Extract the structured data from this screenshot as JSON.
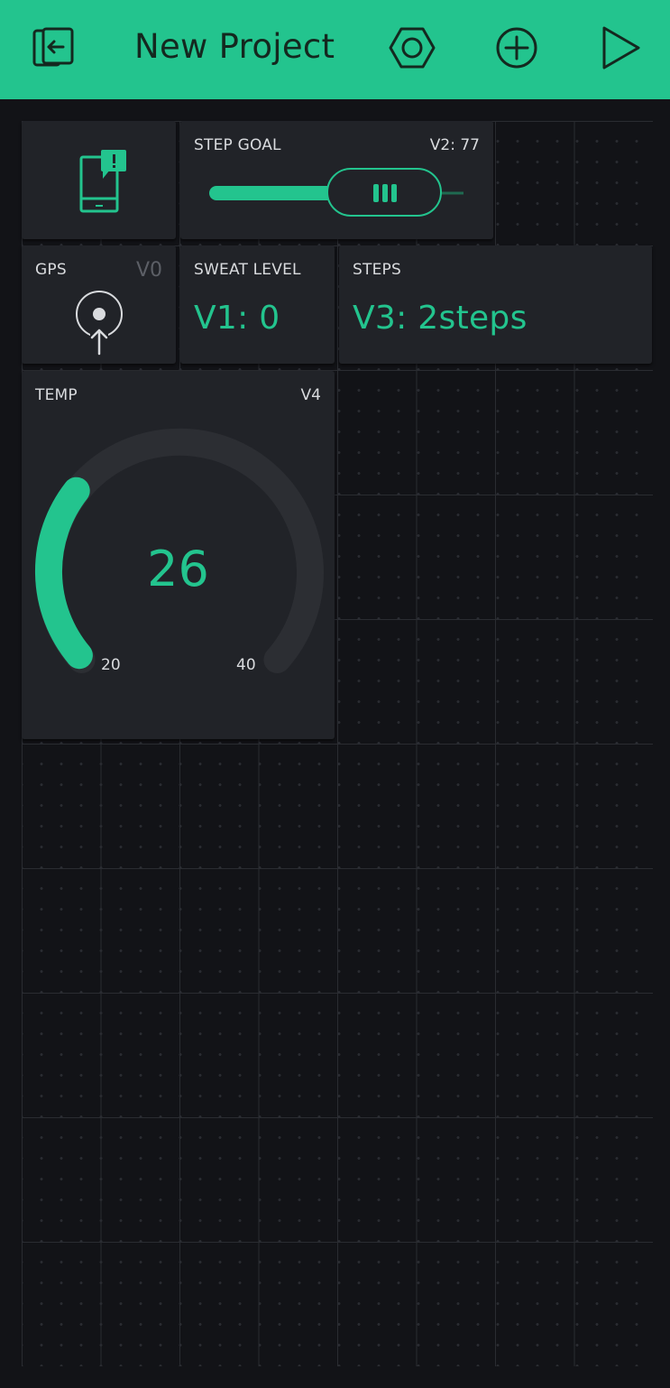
{
  "header": {
    "title": "New Project",
    "background": "#23c48e",
    "icons": [
      "exit-app-icon",
      "settings-hexagon-icon",
      "add-widget-icon",
      "play-icon"
    ]
  },
  "widgets": {
    "notification": {
      "icon": "phone-notification-icon"
    },
    "step_goal": {
      "label": "STEP GOAL",
      "pin_value": "V2: 77",
      "value": 77
    },
    "gps": {
      "label": "GPS",
      "pin": "V0",
      "icon": "gps-stream-icon"
    },
    "sweat_level": {
      "label": "SWEAT LEVEL",
      "value": "V1: 0"
    },
    "steps": {
      "label": "STEPS",
      "value": "V3: 2steps"
    },
    "temp": {
      "label": "TEMP",
      "pin": "V4",
      "value": "26",
      "min": "20",
      "max": "40",
      "level": 26
    }
  },
  "colors": {
    "accent": "#23c48e",
    "widget_bg": "#212328",
    "canvas_bg": "#121317"
  }
}
